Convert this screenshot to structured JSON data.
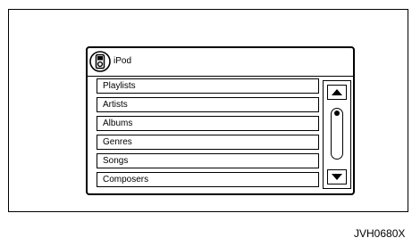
{
  "screen": {
    "title": "iPod",
    "icon": "ipod-icon"
  },
  "menu": {
    "items": [
      {
        "label": "Playlists"
      },
      {
        "label": "Artists"
      },
      {
        "label": "Albums"
      },
      {
        "label": "Genres"
      },
      {
        "label": "Songs"
      },
      {
        "label": "Composers"
      }
    ]
  },
  "scrollbar": {
    "up_icon": "triangle-up-icon",
    "down_icon": "triangle-down-icon"
  },
  "figure": {
    "code": "JVH0680X"
  }
}
